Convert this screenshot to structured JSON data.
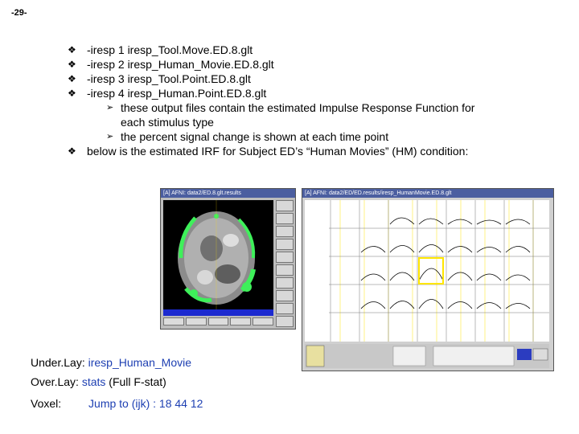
{
  "page_number": "-29-",
  "bullets": [
    {
      "marker": "❖",
      "text": "-iresp 1 iresp_Tool.Move.ED.8.glt"
    },
    {
      "marker": "❖",
      "text": "-iresp 2 iresp_Human_Movie.ED.8.glt"
    },
    {
      "marker": "❖",
      "text": "-iresp 3 iresp_Tool.Point.ED.8.glt"
    },
    {
      "marker": "❖",
      "text": "-iresp 4 iresp_Human.Point.ED.8.glt"
    }
  ],
  "sub_bullets": [
    {
      "marker": "➢",
      "text": "these output files contain the estimated Impulse Response Function for",
      "cont": "each stimulus type"
    },
    {
      "marker": "➢",
      "text": "the percent signal change is shown at each time point"
    }
  ],
  "final_bullet": {
    "marker": "❖",
    "text": "below is the estimated IRF for Subject ED’s “Human Movies” (HM) condition:"
  },
  "afni_window_1": {
    "title": "[A] AFNI: data2/ED.8.glt.results"
  },
  "afni_window_2": {
    "title": "[A] AFNI: data2/ED/ED.results/iresp_HumanMovie.ED.8.glt"
  },
  "info": {
    "underlay_label": "Under.Lay:",
    "underlay_value": "iresp_Human_Movie",
    "overlay_label": "Over.Lay:",
    "overlay_value": "stats",
    "overlay_note": "(Full F-stat)",
    "voxel_label": "Voxel:",
    "voxel_value": "Jump to (ijk) : 18 44 12"
  },
  "colors": {
    "accent_blue": "#1d3fb2",
    "titlebar": "#4b5ea0",
    "overlay_green": "#3ef05a",
    "highlight_yellow": "#ffe600"
  }
}
